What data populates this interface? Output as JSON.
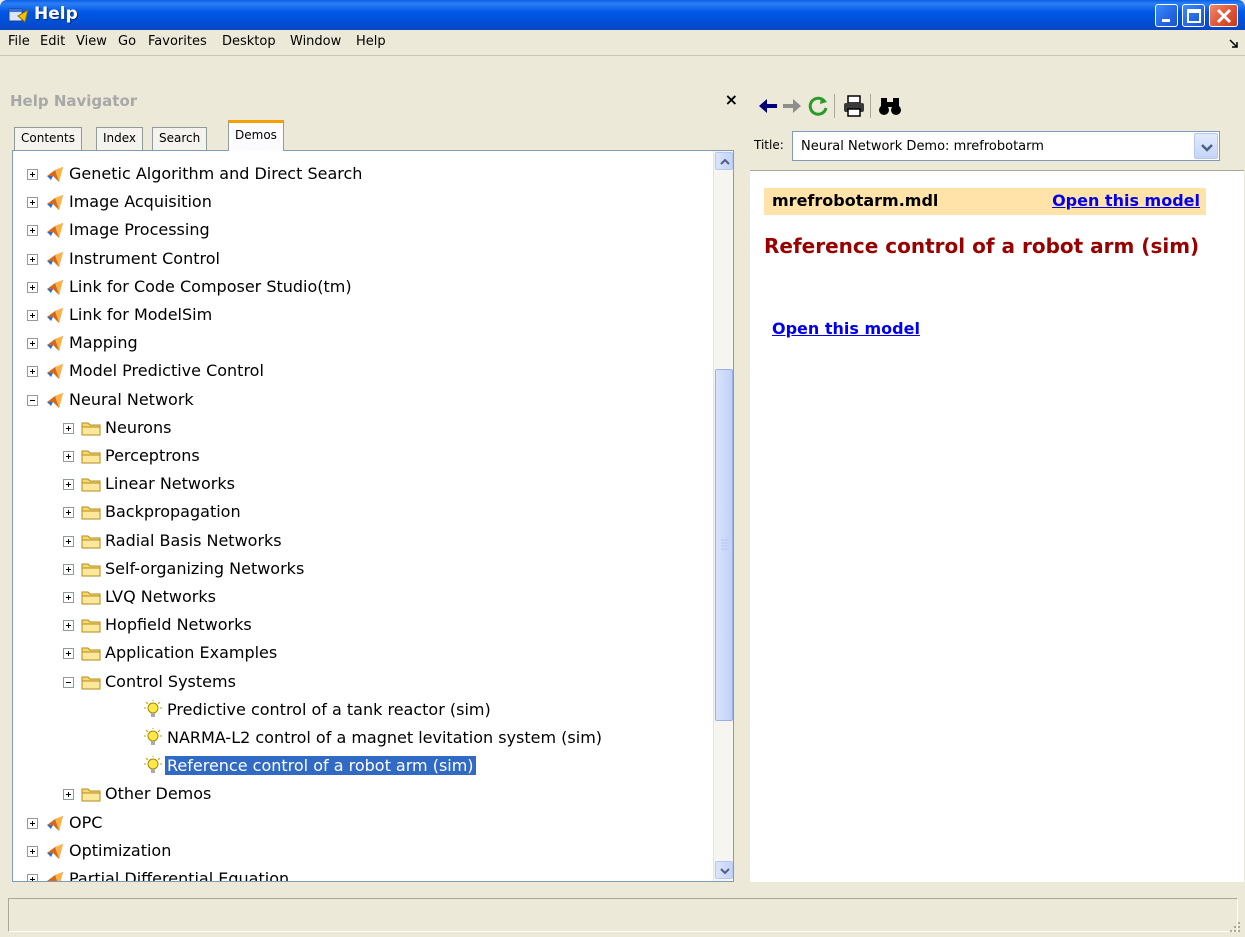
{
  "window": {
    "title": "Help"
  },
  "menu": [
    "File",
    "Edit",
    "View",
    "Go",
    "Favorites",
    "Desktop",
    "Window",
    "Help"
  ],
  "navigator": {
    "title": "Help Navigator",
    "close_symbol": "×",
    "tabs": [
      {
        "label": "Contents",
        "active": false
      },
      {
        "label": "Index",
        "active": false
      },
      {
        "label": "Search",
        "active": false
      },
      {
        "label": "Demos",
        "active": true
      }
    ]
  },
  "tree": [
    {
      "label": "Genetic Algorithm and Direct Search",
      "level": 0,
      "icon": "matlab-icon",
      "expander": "plus"
    },
    {
      "label": "Image Acquisition",
      "level": 0,
      "icon": "matlab-icon",
      "expander": "plus"
    },
    {
      "label": "Image Processing",
      "level": 0,
      "icon": "matlab-icon",
      "expander": "plus"
    },
    {
      "label": "Instrument Control",
      "level": 0,
      "icon": "matlab-icon",
      "expander": "plus"
    },
    {
      "label": "Link for Code Composer Studio(tm)",
      "level": 0,
      "icon": "matlab-icon",
      "expander": "plus"
    },
    {
      "label": "Link for ModelSim",
      "level": 0,
      "icon": "matlab-icon",
      "expander": "plus"
    },
    {
      "label": "Mapping",
      "level": 0,
      "icon": "matlab-icon",
      "expander": "plus"
    },
    {
      "label": "Model Predictive Control",
      "level": 0,
      "icon": "matlab-icon",
      "expander": "plus"
    },
    {
      "label": "Neural Network",
      "level": 0,
      "icon": "matlab-icon",
      "expander": "minus"
    },
    {
      "label": "Neurons",
      "level": 1,
      "icon": "folder-icon",
      "expander": "plus"
    },
    {
      "label": "Perceptrons",
      "level": 1,
      "icon": "folder-icon",
      "expander": "plus"
    },
    {
      "label": "Linear Networks",
      "level": 1,
      "icon": "folder-icon",
      "expander": "plus"
    },
    {
      "label": "Backpropagation",
      "level": 1,
      "icon": "folder-icon",
      "expander": "plus"
    },
    {
      "label": "Radial Basis Networks",
      "level": 1,
      "icon": "folder-icon",
      "expander": "plus"
    },
    {
      "label": "Self-organizing Networks",
      "level": 1,
      "icon": "folder-icon",
      "expander": "plus"
    },
    {
      "label": "LVQ Networks",
      "level": 1,
      "icon": "folder-icon",
      "expander": "plus"
    },
    {
      "label": "Hopfield Networks",
      "level": 1,
      "icon": "folder-icon",
      "expander": "plus"
    },
    {
      "label": "Application Examples",
      "level": 1,
      "icon": "folder-icon",
      "expander": "plus"
    },
    {
      "label": "Control Systems",
      "level": 1,
      "icon": "folder-icon",
      "expander": "minus"
    },
    {
      "label": "Predictive control of a tank reactor (sim)",
      "level": 2,
      "icon": "lightbulb-icon",
      "expander": "none"
    },
    {
      "label": "NARMA-L2 control of a magnet levitation system (sim)",
      "level": 2,
      "icon": "lightbulb-icon",
      "expander": "none"
    },
    {
      "label": "Reference control of a robot arm (sim)",
      "level": 2,
      "icon": "lightbulb-icon",
      "expander": "none",
      "selected": true
    },
    {
      "label": "Other Demos",
      "level": 1,
      "icon": "folder-icon",
      "expander": "plus"
    },
    {
      "label": "OPC",
      "level": 0,
      "icon": "matlab-icon",
      "expander": "plus"
    },
    {
      "label": "Optimization",
      "level": 0,
      "icon": "matlab-icon",
      "expander": "plus"
    },
    {
      "label": "Partial Differential Equation",
      "level": 0,
      "icon": "matlab-icon",
      "expander": "plus"
    }
  ],
  "toolbar": {
    "icons": [
      "back-arrow-icon",
      "forward-arrow-icon",
      "refresh-icon",
      "print-icon",
      "find-binoculars-icon"
    ]
  },
  "page_title": {
    "label": "Title:",
    "value": "Neural Network Demo: mrefrobotarm"
  },
  "document": {
    "filename": "mrefrobotarm.mdl",
    "open_link": "Open this model",
    "heading": "Reference control of a robot arm (sim)",
    "body_link": "Open this model"
  },
  "colors": {
    "titlebar": "#0058e6",
    "selection": "#316ac5",
    "heading": "#990000",
    "link": "#0000ee",
    "doc_bar": "#ffe3a8"
  }
}
